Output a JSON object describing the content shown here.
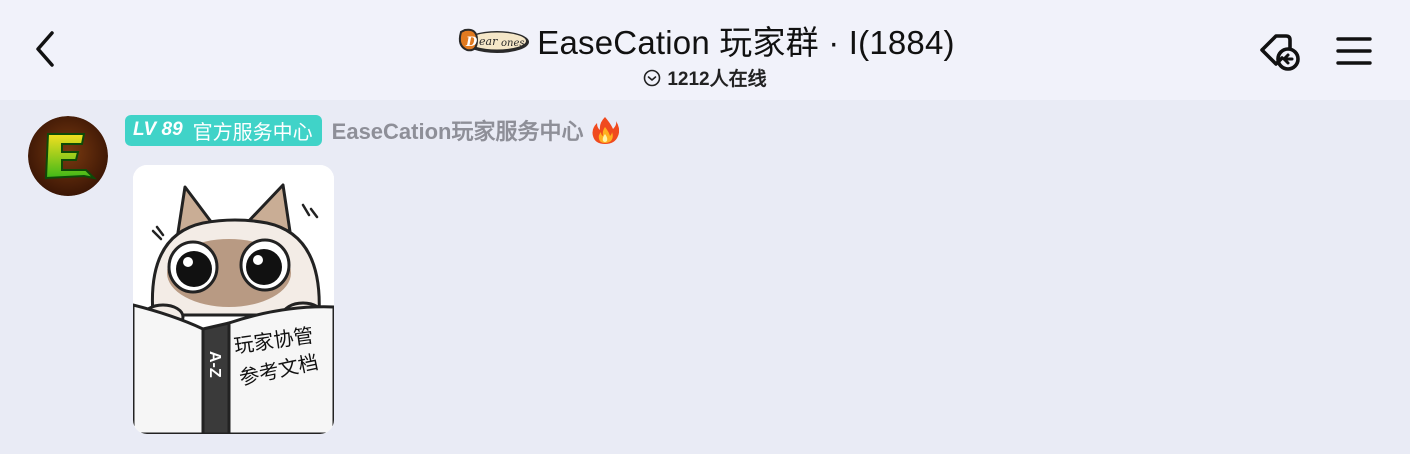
{
  "header": {
    "back_icon": "chevron-left-icon",
    "logo_text": "Dearones",
    "title": "EaseCation 玩家群 · I(1884)",
    "online_icon": "clock-icon",
    "online_text": "1212人在线",
    "tag_icon": "tag-link-icon",
    "menu_icon": "hamburger-menu-icon"
  },
  "message": {
    "avatar_icon": "easecation-logo-avatar",
    "level": "LV 89",
    "role": "官方服务中心",
    "sender": "EaseCation玩家服务中心",
    "sender_emoji": "fire-icon",
    "sticker": {
      "line1": "玩家协管",
      "line2": "参考文档",
      "spine": "A-Z"
    }
  },
  "colors": {
    "background": "#e9ebf5",
    "header_bg": "#f1f2fa",
    "badge": "#40d3c8",
    "sender_name": "#8e8f98"
  }
}
